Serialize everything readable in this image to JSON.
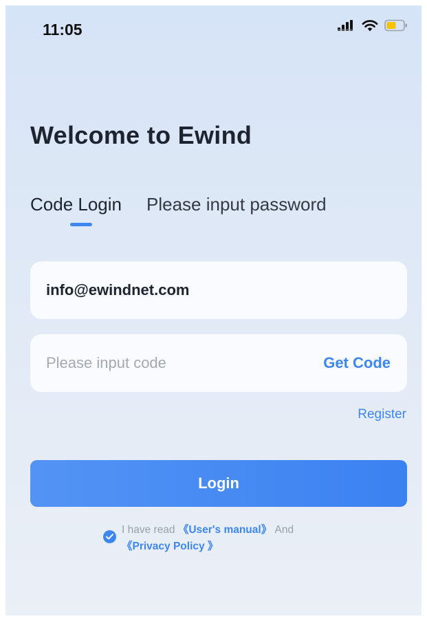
{
  "status_bar": {
    "time": "11:05"
  },
  "icons": {
    "signal": "signal-bars-icon",
    "wifi": "wifi-icon",
    "battery": "battery-low-icon",
    "check": "check-circle-icon"
  },
  "colors": {
    "accent": "#3d86f0",
    "battery_fill": "#f5c400",
    "title": "#1d2430"
  },
  "header": {
    "title": "Welcome to Ewind"
  },
  "tabs": [
    {
      "label": "Code Login",
      "active": true
    },
    {
      "label": "Please input password",
      "active": false
    }
  ],
  "form": {
    "email_value": "info@ewindnet.com",
    "code_placeholder": "Please input code",
    "get_code_label": "Get Code",
    "register_label": "Register",
    "login_label": "Login"
  },
  "agreement": {
    "prefix": "I have read ",
    "manual_link": "《User's manual》",
    "conjunction": " And",
    "privacy_link": "《Privacy Policy 》",
    "checked": true
  }
}
